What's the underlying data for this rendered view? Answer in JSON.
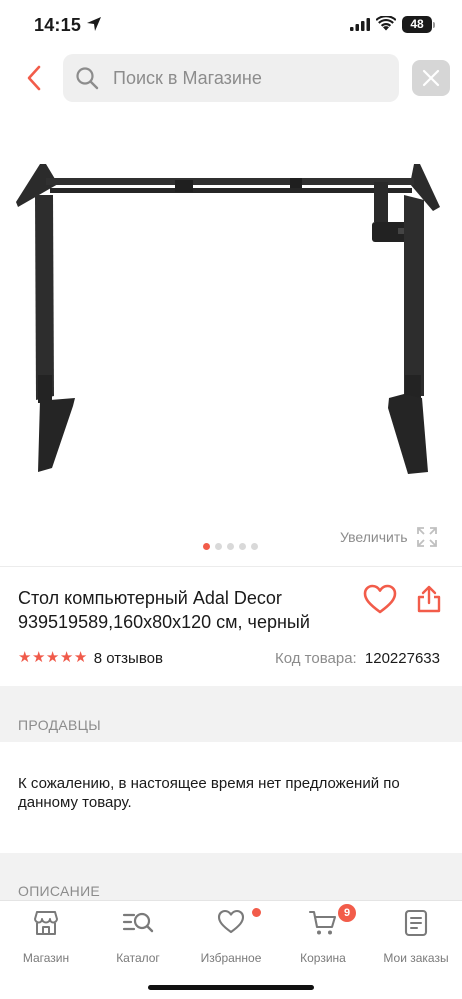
{
  "status_bar": {
    "time": "14:15",
    "battery": "48"
  },
  "search": {
    "placeholder": "Поиск в Магазине",
    "value": ""
  },
  "gallery": {
    "zoom_label": "Увеличить",
    "slide_count": 5,
    "active_slide": 1
  },
  "product": {
    "title": "Стол компьютерный Adal Decor 939519589,160x80x120 см, черный",
    "rating": 5,
    "reviews_label": "8 отзывов",
    "code_label": "Код товара:",
    "code_value": "120227633"
  },
  "sections": {
    "sellers_title": "ПРОДАВЦЫ",
    "no_offers_text": "К сожалению, в настоящее время нет предложений по данному товару.",
    "description_title": "ОПИСАНИЕ"
  },
  "tabbar": {
    "items": [
      {
        "label": "Магазин",
        "icon": "shop-icon"
      },
      {
        "label": "Каталог",
        "icon": "catalog-icon"
      },
      {
        "label": "Избранное",
        "icon": "heart-icon"
      },
      {
        "label": "Корзина",
        "icon": "cart-icon"
      },
      {
        "label": "Мои заказы",
        "icon": "orders-icon"
      }
    ],
    "cart_badge": "9"
  },
  "colors": {
    "accent": "#f25c4a",
    "muted": "#8c8c8c",
    "band": "#f2f2f2"
  }
}
